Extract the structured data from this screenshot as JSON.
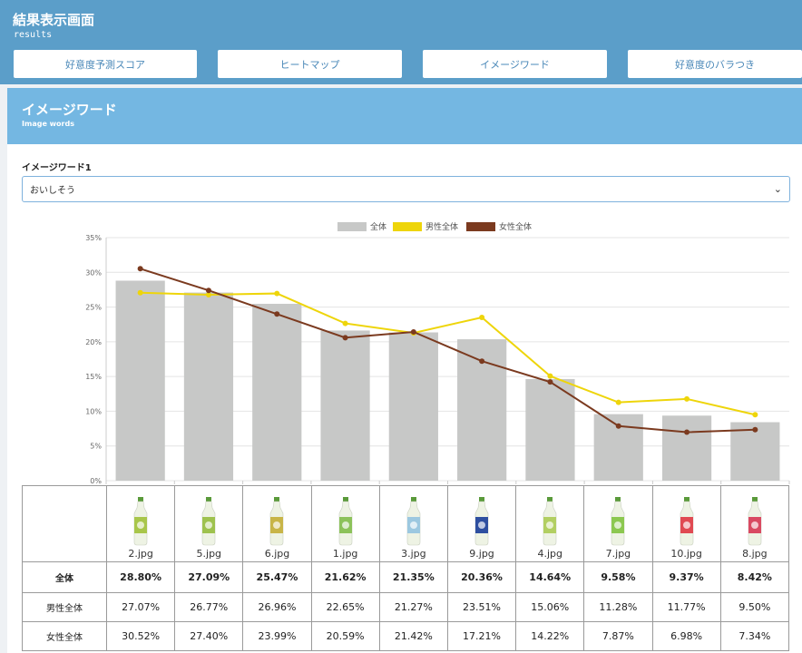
{
  "header": {
    "title": "結果表示画面",
    "subtitle": "results"
  },
  "tabs": [
    {
      "label": "好意度予測スコア"
    },
    {
      "label": "ヒートマップ"
    },
    {
      "label": "イメージワード"
    },
    {
      "label": "好意度のバラつき"
    }
  ],
  "panel": {
    "title": "イメージワード",
    "subtitle": "Image words"
  },
  "image_word_select": {
    "label": "イメージワード1",
    "value": "おいしそう"
  },
  "table": {
    "files": [
      "2.jpg",
      "5.jpg",
      "6.jpg",
      "1.jpg",
      "3.jpg",
      "9.jpg",
      "4.jpg",
      "7.jpg",
      "10.jpg",
      "8.jpg"
    ],
    "bottle_colors": [
      "#a8c64a",
      "#9ec24e",
      "#c8b548",
      "#8cc25a",
      "#9cc8e0",
      "#2e4fa0",
      "#b2cf62",
      "#8cc850",
      "#e04a52",
      "#d94a62"
    ],
    "rows": [
      {
        "label": "全体",
        "values": [
          "28.80%",
          "27.09%",
          "25.47%",
          "21.62%",
          "21.35%",
          "20.36%",
          "14.64%",
          "9.58%",
          "9.37%",
          "8.42%"
        ]
      },
      {
        "label": "男性全体",
        "values": [
          "27.07%",
          "26.77%",
          "26.96%",
          "22.65%",
          "21.27%",
          "23.51%",
          "15.06%",
          "11.28%",
          "11.77%",
          "9.50%"
        ]
      },
      {
        "label": "女性全体",
        "values": [
          "30.52%",
          "27.40%",
          "23.99%",
          "20.59%",
          "21.42%",
          "17.21%",
          "14.22%",
          "7.87%",
          "6.98%",
          "7.34%"
        ]
      }
    ]
  },
  "chart_data": {
    "type": "bar",
    "categories": [
      "2.jpg",
      "5.jpg",
      "6.jpg",
      "1.jpg",
      "3.jpg",
      "9.jpg",
      "4.jpg",
      "7.jpg",
      "10.jpg",
      "8.jpg"
    ],
    "ylim": [
      0,
      35
    ],
    "yticks": [
      "0%",
      "5%",
      "10%",
      "15%",
      "20%",
      "25%",
      "30%",
      "35%"
    ],
    "legend_position": "top-center",
    "grid": true,
    "series": [
      {
        "name": "全体",
        "kind": "bar",
        "color": "#c7c8c7",
        "values": [
          28.8,
          27.09,
          25.47,
          21.62,
          21.35,
          20.36,
          14.64,
          9.58,
          9.37,
          8.42
        ]
      },
      {
        "name": "男性全体",
        "kind": "line",
        "color": "#eed50a",
        "values": [
          27.07,
          26.77,
          26.96,
          22.65,
          21.27,
          23.51,
          15.06,
          11.28,
          11.77,
          9.5
        ]
      },
      {
        "name": "女性全体",
        "kind": "line",
        "color": "#7b3a1f",
        "values": [
          30.52,
          27.4,
          23.99,
          20.59,
          21.42,
          17.21,
          14.22,
          7.87,
          6.98,
          7.34
        ]
      }
    ]
  }
}
